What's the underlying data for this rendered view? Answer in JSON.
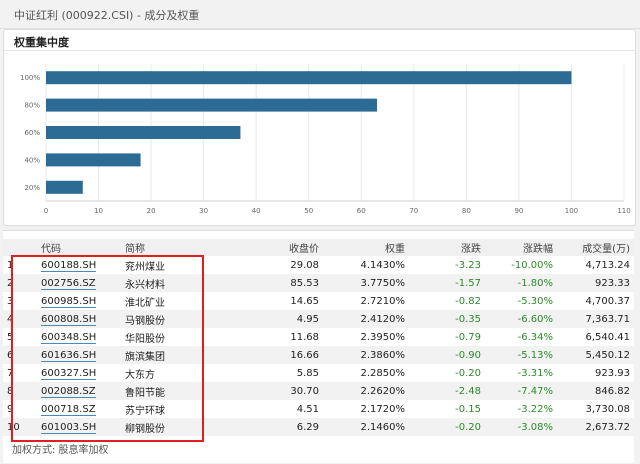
{
  "window": {
    "title": "中证红利 (000922.CSI) - 成分及权重"
  },
  "concentration": {
    "title": "权重集中度"
  },
  "chart_data": {
    "type": "bar",
    "orientation": "horizontal",
    "categories": [
      "100%",
      "80%",
      "60%",
      "40%",
      "20%"
    ],
    "values": [
      100,
      63,
      37,
      18,
      7
    ],
    "x_ticks": [
      0,
      10,
      20,
      30,
      40,
      50,
      60,
      70,
      80,
      90,
      100,
      110
    ],
    "xlim": [
      0,
      110
    ],
    "bar_color": "#2c6b94",
    "grid": true
  },
  "table": {
    "headers": [
      "",
      "代码",
      "简称",
      "收盘价",
      "权重",
      "涨跌",
      "涨跌幅",
      "成交量(万)"
    ],
    "rows": [
      [
        "1",
        "600188.SH",
        "兖州煤业",
        "29.08",
        "4.1430%",
        "-3.23",
        "-10.00%",
        "4,713.24"
      ],
      [
        "2",
        "002756.SZ",
        "永兴材料",
        "85.53",
        "3.7750%",
        "-1.57",
        "-1.80%",
        "923.33"
      ],
      [
        "3",
        "600985.SH",
        "淮北矿业",
        "14.65",
        "2.7210%",
        "-0.82",
        "-5.30%",
        "4,700.37"
      ],
      [
        "4",
        "600808.SH",
        "马钢股份",
        "4.95",
        "2.4120%",
        "-0.35",
        "-6.60%",
        "7,363.71"
      ],
      [
        "5",
        "600348.SH",
        "华阳股份",
        "11.68",
        "2.3950%",
        "-0.79",
        "-6.34%",
        "6,540.41"
      ],
      [
        "6",
        "601636.SH",
        "旗滨集团",
        "16.66",
        "2.3860%",
        "-0.90",
        "-5.13%",
        "5,450.12"
      ],
      [
        "7",
        "600327.SH",
        "大东方",
        "5.85",
        "2.2850%",
        "-0.20",
        "-3.31%",
        "923.93"
      ],
      [
        "8",
        "002088.SZ",
        "鲁阳节能",
        "30.70",
        "2.2620%",
        "-2.48",
        "-7.47%",
        "846.82"
      ],
      [
        "9",
        "000718.SZ",
        "苏宁环球",
        "4.51",
        "2.1720%",
        "-0.15",
        "-3.22%",
        "3,730.08"
      ],
      [
        "10",
        "601003.SH",
        "柳钢股份",
        "6.29",
        "2.1460%",
        "-0.20",
        "-3.08%",
        "2,673.72"
      ]
    ]
  },
  "footer": {
    "note": "加权方式: 股息率加权"
  },
  "colors": {
    "negative": "#2b8a2b",
    "highlight_box": "#e02020"
  }
}
